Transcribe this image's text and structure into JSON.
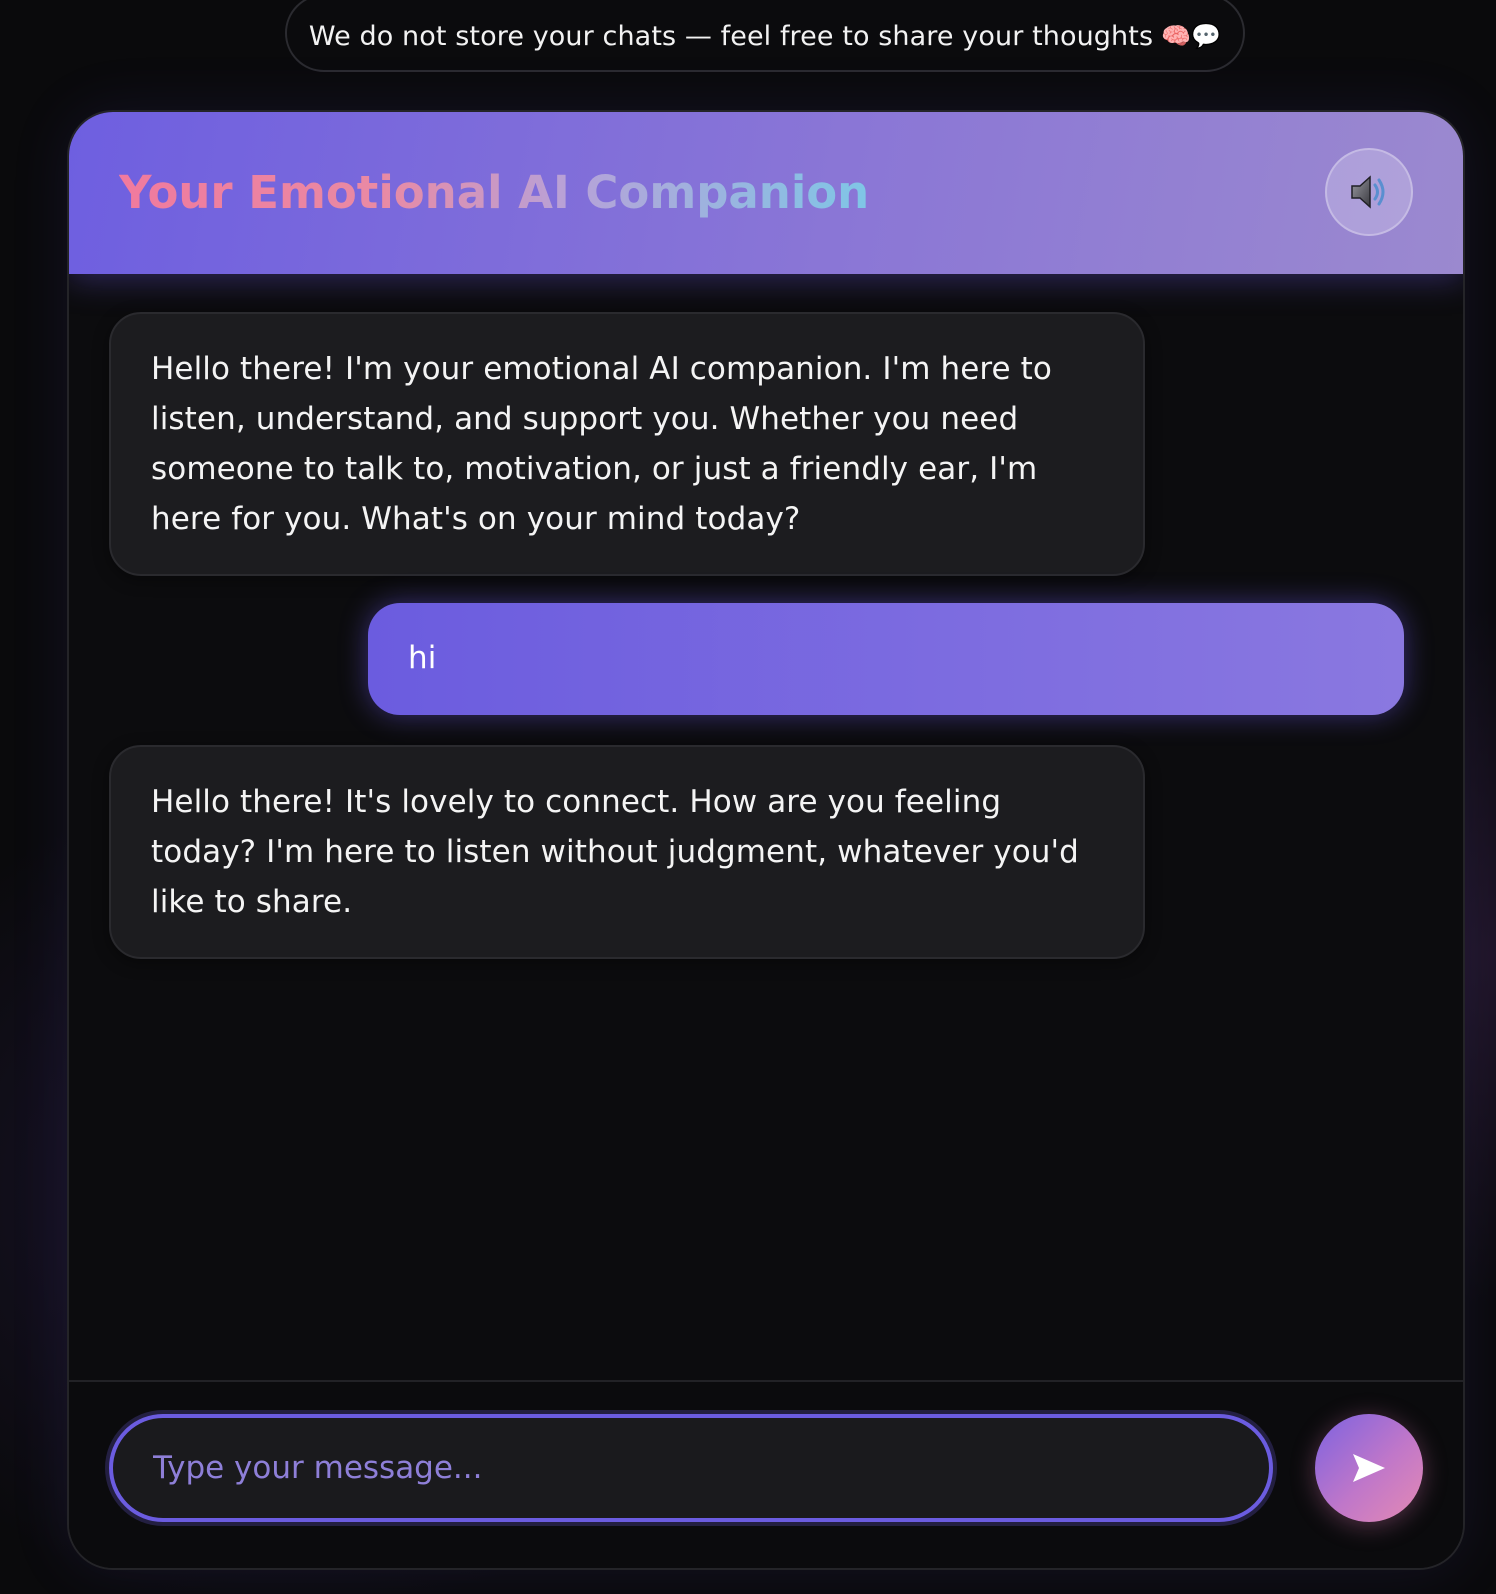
{
  "banner": {
    "text": "We do not store your chats — feel free to share your thoughts",
    "emoji": "🧠💬"
  },
  "header": {
    "title": "Your Emotional AI Companion",
    "sound_icon": "speaker-icon"
  },
  "messages": [
    {
      "role": "bot",
      "text": "Hello there! I'm your emotional AI companion. I'm here to listen, understand, and support you. Whether you need someone to talk to, motivation, or just a friendly ear, I'm here for you. What's on your mind today?"
    },
    {
      "role": "user",
      "text": "hi"
    },
    {
      "role": "bot",
      "text": "Hello there! It's lovely to connect. How are you feeling today? I'm here to listen without judgment, whatever you'd like to share."
    }
  ],
  "composer": {
    "placeholder": "Type your message...",
    "value": "",
    "send_icon": "send-arrow-icon"
  },
  "colors": {
    "accent": "#6b5ce0",
    "header_start": "#6e5fe0",
    "header_end": "#9b89cf",
    "title_pink": "#f07a9e",
    "title_blue": "#7fc6e6",
    "bot_bubble": "#1c1c1f",
    "background": "#0a0a0c"
  }
}
